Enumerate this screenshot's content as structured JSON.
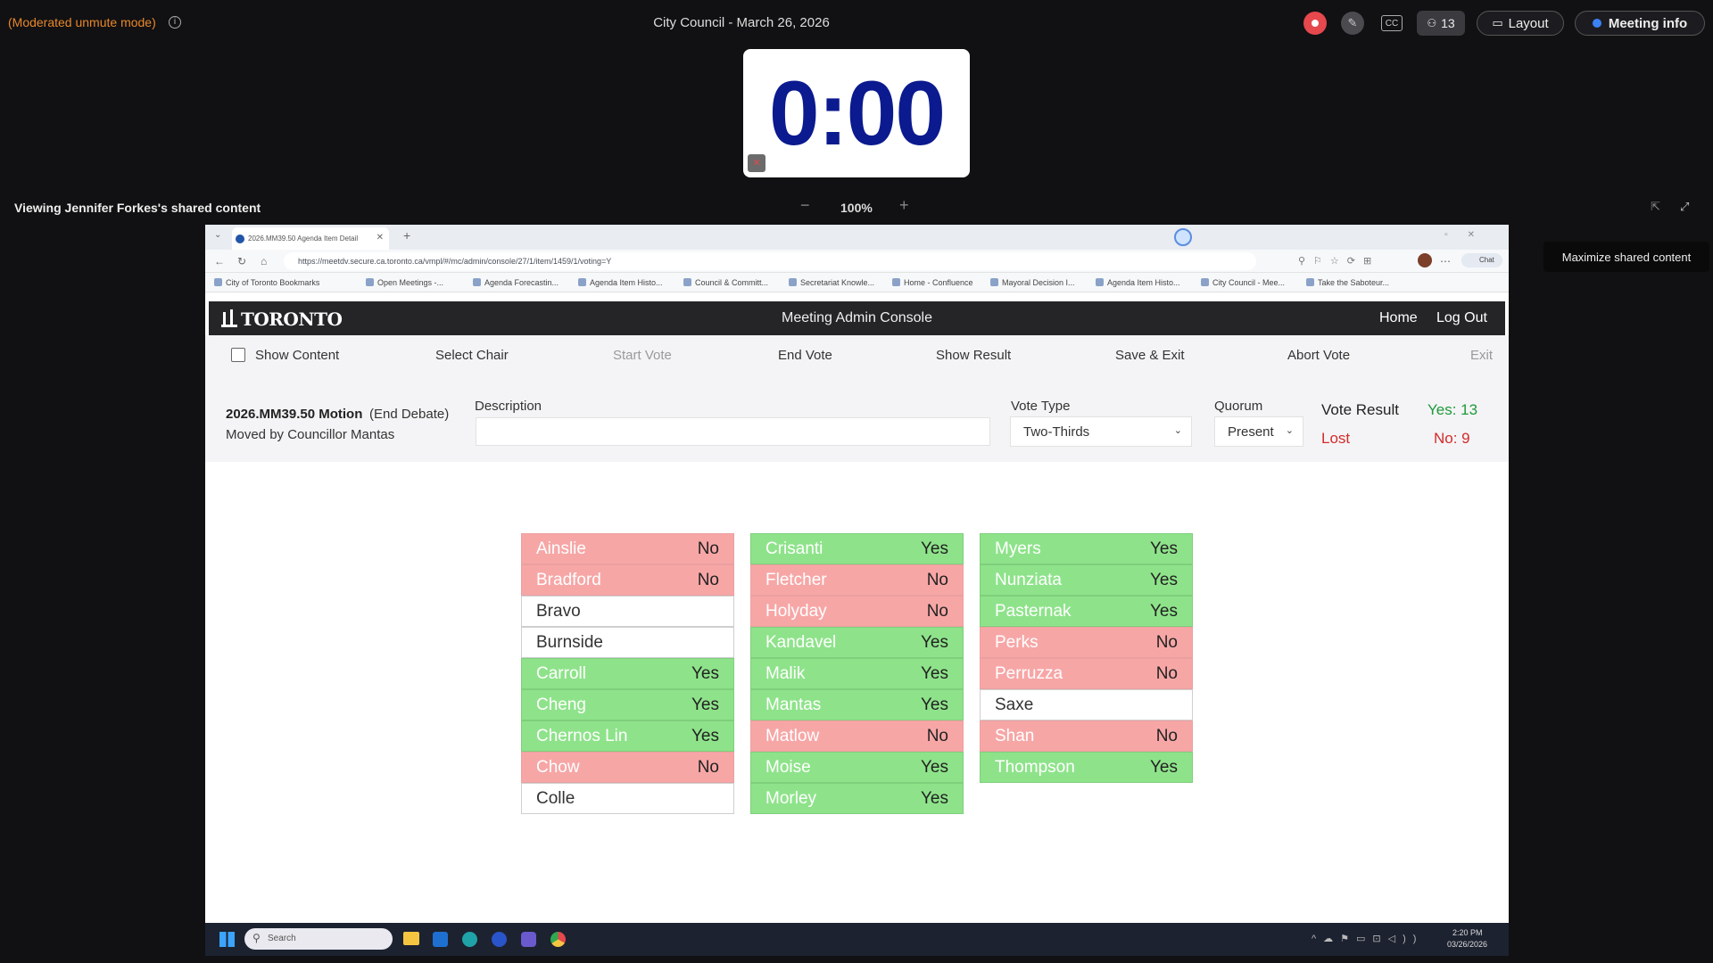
{
  "top_bar": {
    "mode_status": "(Moderated unmute mode)",
    "meeting_title": "City Council - March 26, 2026",
    "participants_count": "13",
    "layout_label": "Layout",
    "meeting_info_label": "Meeting info",
    "record_color": "#e5484d"
  },
  "timer": {
    "value": "0:00",
    "color": "#0b1a8f"
  },
  "share_bar": {
    "viewing_label": "Viewing Jennifer Forkes's shared content",
    "zoom_out": "−",
    "zoom_value": "100%",
    "zoom_in": "+",
    "tooltip": "Maximize shared content"
  },
  "browser": {
    "tab_title": "2026.MM39.50 Agenda Item Detail",
    "url": "https://meetdv.secure.ca.toronto.ca/vmpl/#/mc/admin/console/27/1/item/1459/1/voting=Y",
    "bookmarks": [
      "City of Toronto Bookmarks",
      "Open Meetings -...",
      "Agenda Forecastin...",
      "Agenda Item Histo...",
      "Council & Committ...",
      "Secretariat Knowle...",
      "Home - Confluence",
      "Mayoral Decision I...",
      "Agenda Item Histo...",
      "City Council - Mee...",
      "Take the Saboteur..."
    ],
    "chat_label": "Chat"
  },
  "app": {
    "logo": "TORONTO",
    "title": "Meeting Admin Console",
    "home": "Home",
    "logout": "Log Out"
  },
  "toolbar": {
    "show_content": "Show Content",
    "select_chair": "Select Chair",
    "start_vote": "Start Vote",
    "end_vote": "End Vote",
    "show_result": "Show Result",
    "save_exit": "Save & Exit",
    "abort_vote": "Abort Vote",
    "exit": "Exit"
  },
  "motion": {
    "id": "2026.MM39.50 Motion",
    "type": "(End Debate)",
    "moved_by": "Moved by Councillor Mantas",
    "description_label": "Description",
    "description_value": "",
    "vote_type_label": "Vote Type",
    "vote_type_value": "Two-Thirds",
    "quorum_label": "Quorum",
    "quorum_value": "Present",
    "vote_result_label": "Vote Result",
    "yes_count": "Yes: 13",
    "no_count": "No: 9",
    "outcome": "Lost"
  },
  "votes": {
    "col1": [
      {
        "name": "Ainslie",
        "vote": "No"
      },
      {
        "name": "Bradford",
        "vote": "No"
      },
      {
        "name": "Bravo",
        "vote": ""
      },
      {
        "name": "Burnside",
        "vote": ""
      },
      {
        "name": "Carroll",
        "vote": "Yes"
      },
      {
        "name": "Cheng",
        "vote": "Yes"
      },
      {
        "name": "Chernos Lin",
        "vote": "Yes"
      },
      {
        "name": "Chow",
        "vote": "No"
      },
      {
        "name": "Colle",
        "vote": ""
      }
    ],
    "col2": [
      {
        "name": "Crisanti",
        "vote": "Yes"
      },
      {
        "name": "Fletcher",
        "vote": "No"
      },
      {
        "name": "Holyday",
        "vote": "No"
      },
      {
        "name": "Kandavel",
        "vote": "Yes"
      },
      {
        "name": "Malik",
        "vote": "Yes"
      },
      {
        "name": "Mantas",
        "vote": "Yes"
      },
      {
        "name": "Matlow",
        "vote": "No"
      },
      {
        "name": "Moise",
        "vote": "Yes"
      },
      {
        "name": "Morley",
        "vote": "Yes"
      }
    ],
    "col3": [
      {
        "name": "Myers",
        "vote": "Yes"
      },
      {
        "name": "Nunziata",
        "vote": "Yes"
      },
      {
        "name": "Pasternak",
        "vote": "Yes"
      },
      {
        "name": "Perks",
        "vote": "No"
      },
      {
        "name": "Perruzza",
        "vote": "No"
      },
      {
        "name": "Saxe",
        "vote": ""
      },
      {
        "name": "Shan",
        "vote": "No"
      },
      {
        "name": "Thompson",
        "vote": "Yes"
      }
    ]
  },
  "taskbar": {
    "search_placeholder": "Search",
    "time": "2:20 PM",
    "date": "03/26/2026"
  }
}
